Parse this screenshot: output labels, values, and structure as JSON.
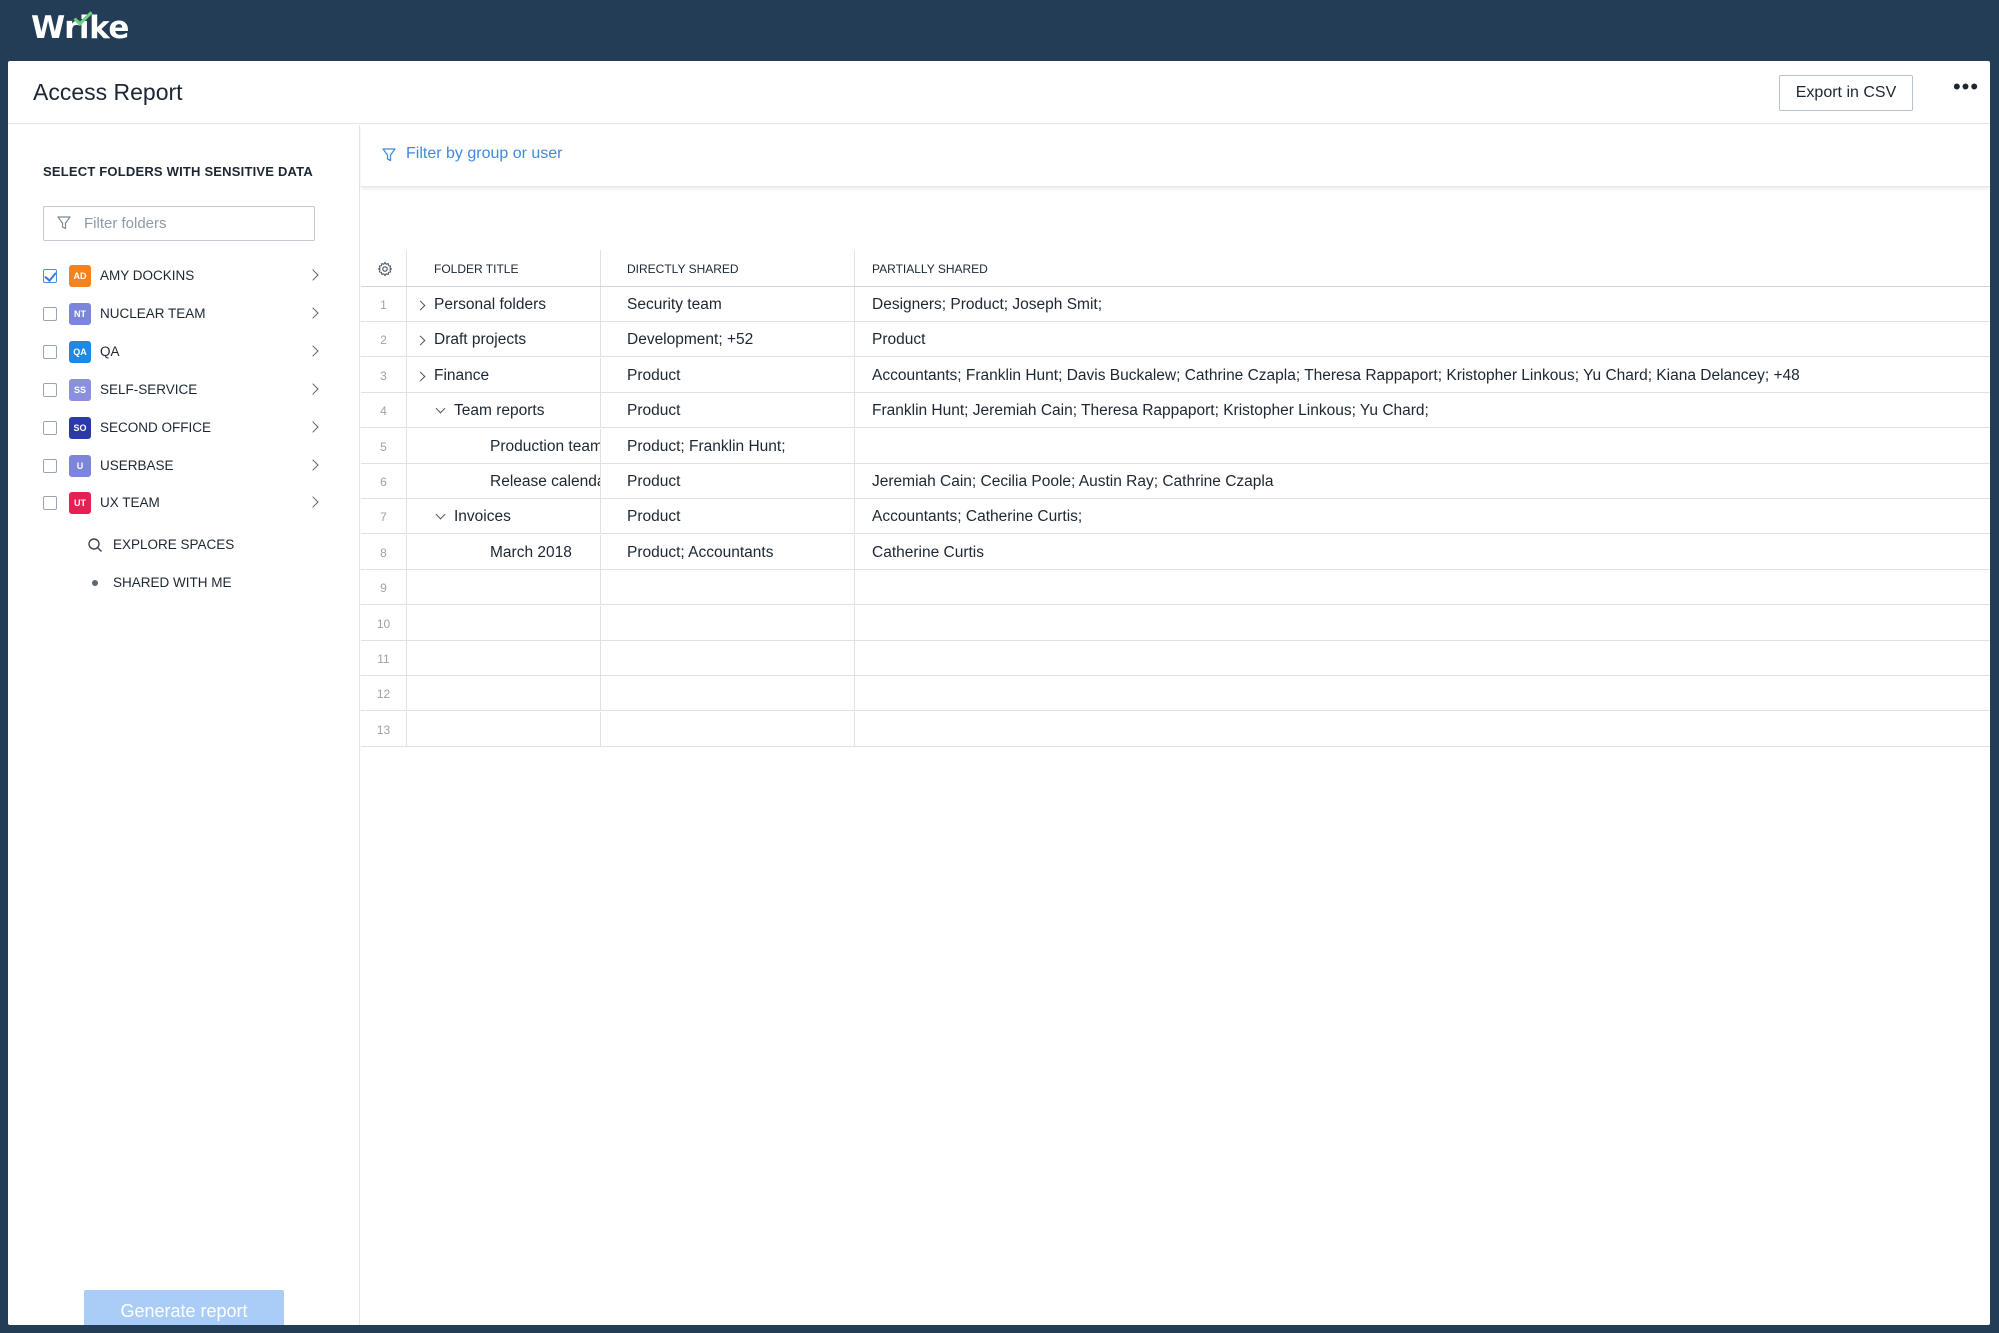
{
  "app": {
    "brand": "Wrike"
  },
  "header": {
    "title": "Access Report",
    "export_label": "Export in CSV",
    "more_label": "•••"
  },
  "sidebar": {
    "heading": "SELECT FOLDERS WITH SENSITIVE DATA",
    "filter_placeholder": "Filter folders",
    "spaces": [
      {
        "initials": "AD",
        "label": "AMY DOCKINS",
        "checked": true,
        "color": "#f5821f"
      },
      {
        "initials": "NT",
        "label": "NUCLEAR TEAM",
        "checked": false,
        "color": "#7b86d9"
      },
      {
        "initials": "QA",
        "label": "QA",
        "checked": false,
        "color": "#1e88e5"
      },
      {
        "initials": "SS",
        "label": "SELF-SERVICE",
        "checked": false,
        "color": "#8a8fe0"
      },
      {
        "initials": "SO",
        "label": "SECOND OFFICE",
        "checked": false,
        "color": "#2b3aa8"
      },
      {
        "initials": "U",
        "label": "USERBASE",
        "checked": false,
        "color": "#7b86d9"
      },
      {
        "initials": "UT",
        "label": "UX TEAM",
        "checked": false,
        "color": "#e91e52"
      }
    ],
    "explore_label": "EXPLORE SPACES",
    "shared_label": "SHARED WITH ME",
    "generate_label": "Generate report"
  },
  "main": {
    "filter_label": "Filter by group or user",
    "columns": {
      "folder_title": "FOLDER TITLE",
      "directly_shared": "DIRECTLY SHARED",
      "partially_shared": "PARTIALLY SHARED"
    },
    "rows": [
      {
        "num": "1",
        "title": "Personal folders",
        "indent": 0,
        "expander": "right",
        "direct": "Security team",
        "partial": "Designers; Product; Joseph Smit;"
      },
      {
        "num": "2",
        "title": "Draft projects",
        "indent": 0,
        "expander": "right",
        "direct": "Development; +52",
        "partial": "Product"
      },
      {
        "num": "3",
        "title": "Finance",
        "indent": 0,
        "expander": "right",
        "direct": "Product",
        "partial": "Accountants; Franklin Hunt; Davis Buckalew; Cathrine Czapla; Theresa Rappaport; Kristopher Linkous; Yu Chard; Kiana Delancey; +48"
      },
      {
        "num": "4",
        "title": "Team reports",
        "indent": 1,
        "expander": "down",
        "direct": "Product",
        "partial": "Franklin Hunt; Jeremiah Cain; Theresa Rappaport; Kristopher Linkous; Yu Chard;"
      },
      {
        "num": "5",
        "title": "Production team",
        "indent": 2,
        "expander": "none",
        "direct": "Product;  Franklin Hunt;",
        "partial": ""
      },
      {
        "num": "6",
        "title": "Release calendar",
        "indent": 2,
        "expander": "none",
        "direct": "Product",
        "partial": "Jeremiah Cain; Cecilia Poole; Austin Ray; Cathrine Czapla"
      },
      {
        "num": "7",
        "title": "Invoices",
        "indent": 1,
        "expander": "down",
        "direct": "Product",
        "partial": "Accountants; Catherine Curtis;"
      },
      {
        "num": "8",
        "title": "March 2018",
        "indent": 2,
        "expander": "none",
        "direct": "Product; Accountants",
        "partial": "Catherine Curtis"
      },
      {
        "num": "9",
        "title": "",
        "indent": 0,
        "expander": "none",
        "direct": "",
        "partial": ""
      },
      {
        "num": "10",
        "title": "",
        "indent": 0,
        "expander": "none",
        "direct": "",
        "partial": ""
      },
      {
        "num": "11",
        "title": "",
        "indent": 0,
        "expander": "none",
        "direct": "",
        "partial": ""
      },
      {
        "num": "12",
        "title": "",
        "indent": 0,
        "expander": "none",
        "direct": "",
        "partial": ""
      },
      {
        "num": "13",
        "title": "",
        "indent": 0,
        "expander": "none",
        "direct": "",
        "partial": ""
      }
    ]
  },
  "icons": {
    "filter": "filter-icon",
    "gear": "gear-icon",
    "search": "search-icon",
    "chevron": "chevron-right-icon"
  },
  "colors": {
    "topbar": "#243d56",
    "link": "#3f8ae0",
    "generate_disabled": "#a9cdf7"
  }
}
